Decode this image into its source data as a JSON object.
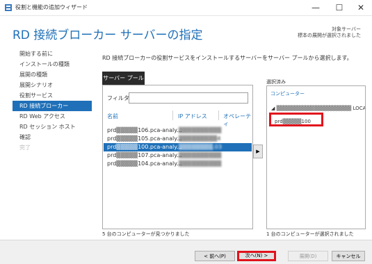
{
  "window": {
    "title": "役割と機能の追加ウィザード",
    "minimize": "—",
    "maximize": "☐",
    "close": "✕"
  },
  "header": {
    "title": "RD 接続ブローカー サーバーの指定",
    "target_label": "対象サーバー",
    "target_value": "標本の展開が選択されました"
  },
  "sidebar": {
    "items": [
      {
        "label": "開始する前に",
        "state": "normal"
      },
      {
        "label": "インストールの種類",
        "state": "normal"
      },
      {
        "label": "展開の種類",
        "state": "normal"
      },
      {
        "label": "展開シナリオ",
        "state": "normal"
      },
      {
        "label": "役割サービス",
        "state": "normal"
      },
      {
        "label": "RD 接続ブローカー",
        "state": "active"
      },
      {
        "label": "RD Web アクセス",
        "state": "normal"
      },
      {
        "label": "RD セッション ホスト",
        "state": "normal"
      },
      {
        "label": "確認",
        "state": "normal"
      },
      {
        "label": "完了",
        "state": "disabled"
      }
    ]
  },
  "main": {
    "description": "RD 接続ブローカーの役割サービスをインストールするサーバーをサーバー プールから選択します。",
    "pool_tab": "サーバー プール",
    "filter_label": "フィルター:",
    "filter_value": "",
    "columns": [
      "名前",
      "IP アドレス",
      "オペレーティ"
    ],
    "rows": [
      {
        "name": "prd▒▒▒▒▒106.pca-analy...",
        "ip": "▒▒▒▒▒▒▒▒▒▒",
        "selected": false
      },
      {
        "name": "prd▒▒▒▒▒105.pca-analy...",
        "ip": "▒▒▒▒▒▒▒▒▒4",
        "selected": false
      },
      {
        "name": "prd▒▒▒▒▒100.pca-analy...",
        "ip": "▒▒▒▒▒▒▒▒.03",
        "selected": true
      },
      {
        "name": "prd▒▒▒▒▒107.pca-analy...",
        "ip": "▒▒▒▒▒▒▒▒▒▒",
        "selected": false
      },
      {
        "name": "prd▒▒▒▒▒104.pca-analy...",
        "ip": "▒▒▒▒▒▒▒▒▒▒",
        "selected": false
      }
    ],
    "found_count": "5 台のコンピューターが見つかりました",
    "arrow": "▶"
  },
  "selected": {
    "label": "選択済み",
    "header": "コンピューター",
    "group": "◢ ▒▒▒▒▒▒▒▒▒▒▒▒▒▒▒▒▒▒▒▒ LOCA",
    "item": "prd▒▒▒▒▒100",
    "count": "1 台のコンピューターが選択されました"
  },
  "footer": {
    "prev": "< 前へ(P)",
    "next": "次へ(N) >",
    "deploy": "展開(D)",
    "cancel": "キャンセル"
  },
  "colors": {
    "accent": "#1f70b8",
    "highlight": "#e1121c"
  }
}
